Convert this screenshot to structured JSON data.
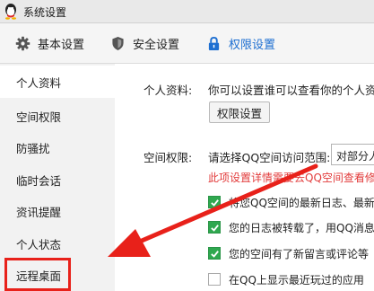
{
  "window": {
    "title": "系统设置"
  },
  "tabs": [
    {
      "label": "基本设置",
      "icon": "gear-icon"
    },
    {
      "label": "安全设置",
      "icon": "shield-icon"
    },
    {
      "label": "权限设置",
      "icon": "lock-icon",
      "active": true
    }
  ],
  "sidebar": {
    "items": [
      {
        "label": "个人资料",
        "active": true
      },
      {
        "label": "空间权限"
      },
      {
        "label": "防骚扰"
      },
      {
        "label": "临时会话"
      },
      {
        "label": "资讯提醒"
      },
      {
        "label": "个人状态"
      },
      {
        "label": "远程桌面",
        "highlighted": true
      }
    ]
  },
  "main": {
    "personal": {
      "label": "个人资料:",
      "text": "你可以设置谁可以查看你的个人资料",
      "button_label": "权限设置"
    },
    "space": {
      "label": "空间权限:",
      "prompt": "请选择QQ空间访问范围:",
      "select_value": "对部分人",
      "warning": "此项设置详情需要去QQ空间查看修",
      "options": [
        {
          "label": "将您QQ空间的最新日志、最新",
          "checked": true
        },
        {
          "label": "您的日志被转载了，用QQ消息",
          "checked": true
        },
        {
          "label": "您的空间有了新留言或评论等",
          "checked": true
        },
        {
          "label": "在QQ上显示最近玩过的应用",
          "checked": false
        }
      ]
    }
  },
  "colors": {
    "accent": "#1e6fd1",
    "warning": "#e23b3b",
    "highlight": "#e8211a",
    "checkbox": "#2fa84f"
  }
}
